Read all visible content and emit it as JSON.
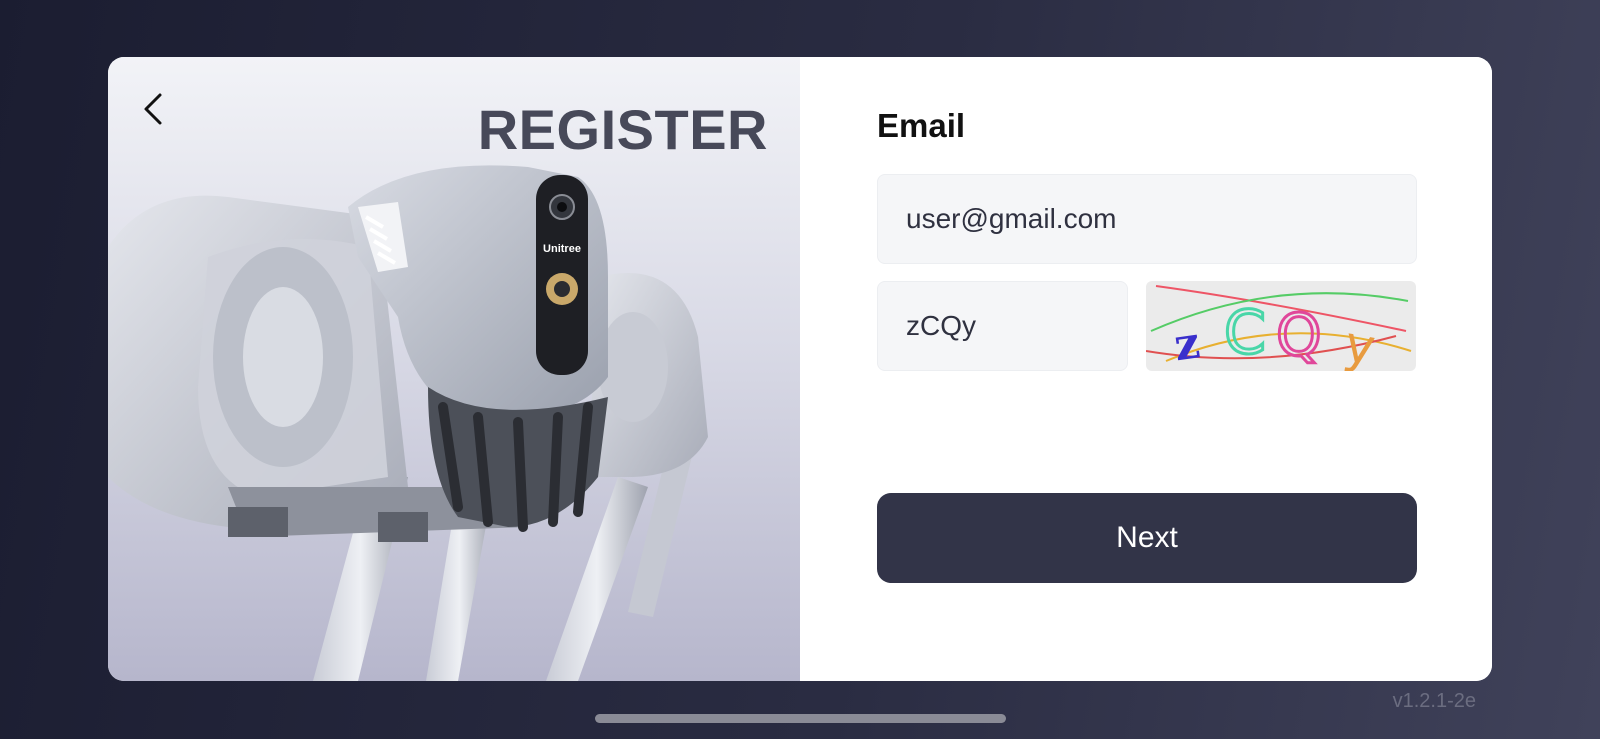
{
  "page": {
    "title": "REGISTER"
  },
  "robot_image": {
    "brand_text": "Unitree"
  },
  "form": {
    "email_label": "Email",
    "email_value": "user@gmail.com",
    "captcha_value": "zCQy",
    "captcha_image_text": "zCQy",
    "next_label": "Next"
  },
  "footer": {
    "version": "v1.2.1-2e"
  },
  "icons": {
    "back": "chevron-left-icon"
  },
  "colors": {
    "background": "#1f2135",
    "primary_button": "#323448",
    "title": "#474959",
    "input_bg": "#f5f6f8"
  }
}
